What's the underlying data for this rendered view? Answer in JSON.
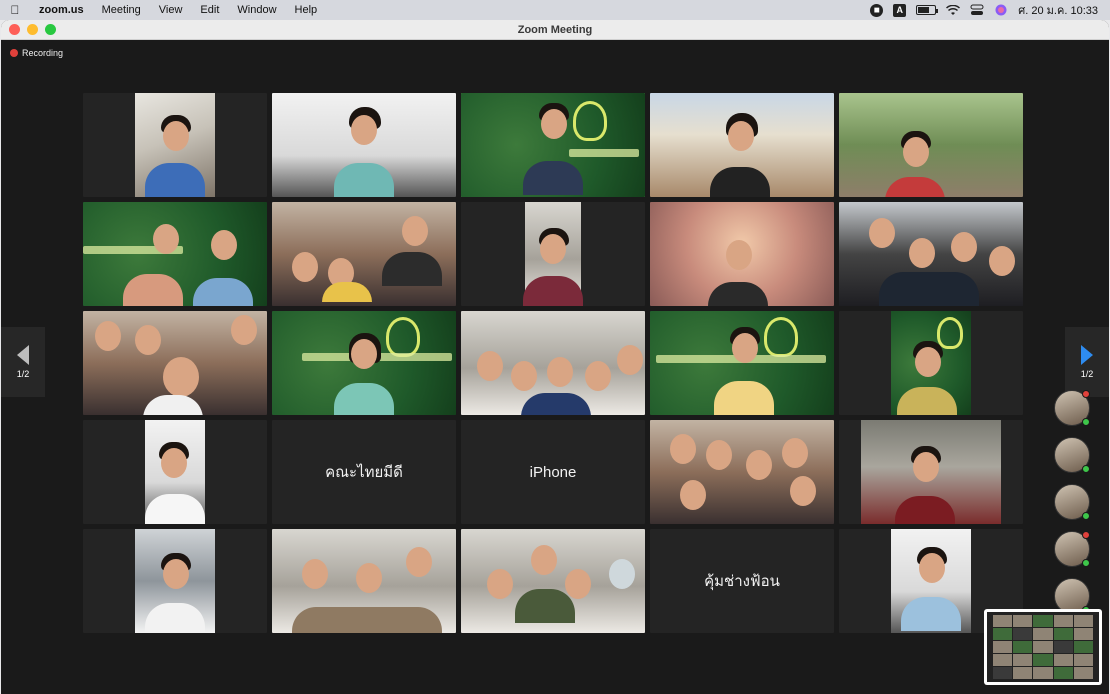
{
  "menubar": {
    "app": "zoom.us",
    "items": [
      "Meeting",
      "View",
      "Edit",
      "Window",
      "Help"
    ],
    "input_icon_label": "A",
    "clock": "ศ. 20 ม.ค.  10:33"
  },
  "window": {
    "title": "Zoom Meeting"
  },
  "recording": {
    "label": "Recording"
  },
  "pager": {
    "left_label": "1/2",
    "right_label": "1/2"
  },
  "tiles": [
    {
      "name": ""
    },
    {
      "name": ""
    },
    {
      "name": ""
    },
    {
      "name": ""
    },
    {
      "name": ""
    },
    {
      "name": ""
    },
    {
      "name": ""
    },
    {
      "name": ""
    },
    {
      "name": ""
    },
    {
      "name": ""
    },
    {
      "name": ""
    },
    {
      "name": ""
    },
    {
      "name": ""
    },
    {
      "name": ""
    },
    {
      "name": ""
    },
    {
      "name": ""
    },
    {
      "name": "คณะไทยมีดี"
    },
    {
      "name": "iPhone"
    },
    {
      "name": ""
    },
    {
      "name": ""
    },
    {
      "name": ""
    },
    {
      "name": ""
    },
    {
      "name": ""
    },
    {
      "name": "คุ้มช่างฟ้อน"
    },
    {
      "name": ""
    }
  ],
  "colors": {
    "active_speaker": "#7ecb55",
    "recording": "#e0413b",
    "next_arrow": "#2e8cf0"
  }
}
